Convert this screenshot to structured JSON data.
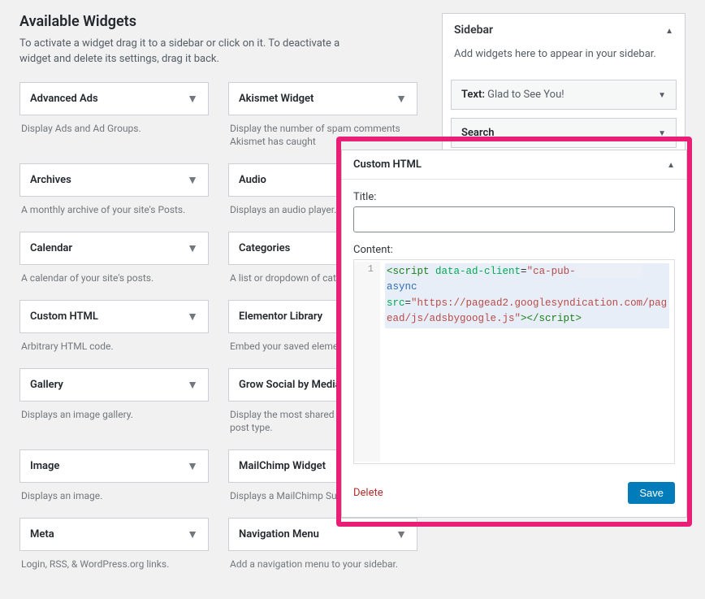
{
  "available": {
    "title": "Available Widgets",
    "subtitle": "To activate a widget drag it to a sidebar or click on it. To deactivate a widget and delete its settings, drag it back.",
    "items": [
      {
        "label": "Advanced Ads",
        "desc": "Display Ads and Ad Groups."
      },
      {
        "label": "Akismet Widget",
        "desc": "Display the number of spam comments Akismet has caught"
      },
      {
        "label": "Archives",
        "desc": "A monthly archive of your site's Posts."
      },
      {
        "label": "Audio",
        "desc": "Displays an audio player."
      },
      {
        "label": "Calendar",
        "desc": "A calendar of your site's posts."
      },
      {
        "label": "Categories",
        "desc": "A list or dropdown of categories."
      },
      {
        "label": "Custom HTML",
        "desc": "Arbitrary HTML code."
      },
      {
        "label": "Elementor Library",
        "desc": "Embed your saved elements."
      },
      {
        "label": "Gallery",
        "desc": "Displays an image gallery."
      },
      {
        "label": "Grow Social by Mediavine",
        "desc": "Display the most shared posts for custom post type."
      },
      {
        "label": "Image",
        "desc": "Displays an image."
      },
      {
        "label": "MailChimp Widget",
        "desc": "Displays a MailChimp Subscribe form."
      },
      {
        "label": "Meta",
        "desc": "Login, RSS, & WordPress.org links."
      },
      {
        "label": "Navigation Menu",
        "desc": "Add a navigation menu to your sidebar."
      }
    ]
  },
  "sidebar": {
    "title": "Sidebar",
    "hint": "Add widgets here to appear in your sidebar.",
    "widgets": [
      {
        "prefix": "Text:",
        "subfix": " Glad to See You!"
      },
      {
        "prefix": "Search",
        "subfix": ""
      }
    ]
  },
  "editor": {
    "heading": "Custom HTML",
    "title_label": "Title:",
    "title_value": "",
    "content_label": "Content:",
    "gutter": "1",
    "code": {
      "open_tag": "<script",
      "attr1_name": " data-ad-client",
      "attr1_eq": "=",
      "attr1_val": "\"ca-pub-",
      "redacted": "           ",
      "async_kw": "async",
      "src_name": "src",
      "src_eq": "=",
      "src_val": "\"https://pagead2.googlesyndication.com/pagead/js/adsbygoogle.js\"",
      "close": "></script>"
    },
    "delete": "Delete",
    "save": "Save"
  }
}
